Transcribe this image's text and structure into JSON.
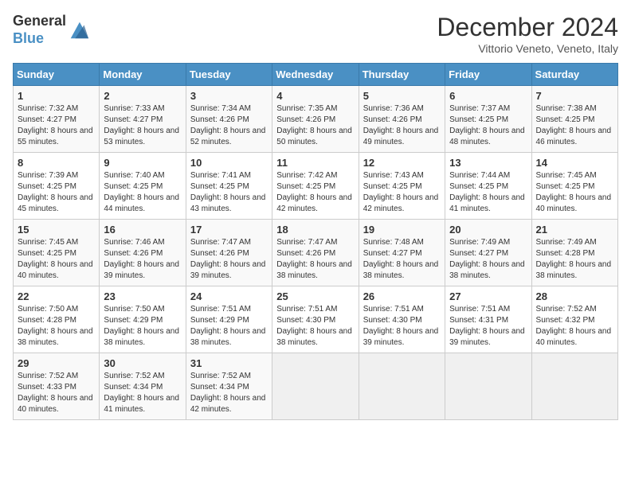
{
  "header": {
    "logo_line1": "General",
    "logo_line2": "Blue",
    "month_title": "December 2024",
    "subtitle": "Vittorio Veneto, Veneto, Italy"
  },
  "days_of_week": [
    "Sunday",
    "Monday",
    "Tuesday",
    "Wednesday",
    "Thursday",
    "Friday",
    "Saturday"
  ],
  "weeks": [
    [
      {
        "day": "1",
        "sunrise": "7:32 AM",
        "sunset": "4:27 PM",
        "daylight": "8 hours and 55 minutes."
      },
      {
        "day": "2",
        "sunrise": "7:33 AM",
        "sunset": "4:27 PM",
        "daylight": "8 hours and 53 minutes."
      },
      {
        "day": "3",
        "sunrise": "7:34 AM",
        "sunset": "4:26 PM",
        "daylight": "8 hours and 52 minutes."
      },
      {
        "day": "4",
        "sunrise": "7:35 AM",
        "sunset": "4:26 PM",
        "daylight": "8 hours and 50 minutes."
      },
      {
        "day": "5",
        "sunrise": "7:36 AM",
        "sunset": "4:26 PM",
        "daylight": "8 hours and 49 minutes."
      },
      {
        "day": "6",
        "sunrise": "7:37 AM",
        "sunset": "4:25 PM",
        "daylight": "8 hours and 48 minutes."
      },
      {
        "day": "7",
        "sunrise": "7:38 AM",
        "sunset": "4:25 PM",
        "daylight": "8 hours and 46 minutes."
      }
    ],
    [
      {
        "day": "8",
        "sunrise": "7:39 AM",
        "sunset": "4:25 PM",
        "daylight": "8 hours and 45 minutes."
      },
      {
        "day": "9",
        "sunrise": "7:40 AM",
        "sunset": "4:25 PM",
        "daylight": "8 hours and 44 minutes."
      },
      {
        "day": "10",
        "sunrise": "7:41 AM",
        "sunset": "4:25 PM",
        "daylight": "8 hours and 43 minutes."
      },
      {
        "day": "11",
        "sunrise": "7:42 AM",
        "sunset": "4:25 PM",
        "daylight": "8 hours and 42 minutes."
      },
      {
        "day": "12",
        "sunrise": "7:43 AM",
        "sunset": "4:25 PM",
        "daylight": "8 hours and 42 minutes."
      },
      {
        "day": "13",
        "sunrise": "7:44 AM",
        "sunset": "4:25 PM",
        "daylight": "8 hours and 41 minutes."
      },
      {
        "day": "14",
        "sunrise": "7:45 AM",
        "sunset": "4:25 PM",
        "daylight": "8 hours and 40 minutes."
      }
    ],
    [
      {
        "day": "15",
        "sunrise": "7:45 AM",
        "sunset": "4:25 PM",
        "daylight": "8 hours and 40 minutes."
      },
      {
        "day": "16",
        "sunrise": "7:46 AM",
        "sunset": "4:26 PM",
        "daylight": "8 hours and 39 minutes."
      },
      {
        "day": "17",
        "sunrise": "7:47 AM",
        "sunset": "4:26 PM",
        "daylight": "8 hours and 39 minutes."
      },
      {
        "day": "18",
        "sunrise": "7:47 AM",
        "sunset": "4:26 PM",
        "daylight": "8 hours and 38 minutes."
      },
      {
        "day": "19",
        "sunrise": "7:48 AM",
        "sunset": "4:27 PM",
        "daylight": "8 hours and 38 minutes."
      },
      {
        "day": "20",
        "sunrise": "7:49 AM",
        "sunset": "4:27 PM",
        "daylight": "8 hours and 38 minutes."
      },
      {
        "day": "21",
        "sunrise": "7:49 AM",
        "sunset": "4:28 PM",
        "daylight": "8 hours and 38 minutes."
      }
    ],
    [
      {
        "day": "22",
        "sunrise": "7:50 AM",
        "sunset": "4:28 PM",
        "daylight": "8 hours and 38 minutes."
      },
      {
        "day": "23",
        "sunrise": "7:50 AM",
        "sunset": "4:29 PM",
        "daylight": "8 hours and 38 minutes."
      },
      {
        "day": "24",
        "sunrise": "7:51 AM",
        "sunset": "4:29 PM",
        "daylight": "8 hours and 38 minutes."
      },
      {
        "day": "25",
        "sunrise": "7:51 AM",
        "sunset": "4:30 PM",
        "daylight": "8 hours and 38 minutes."
      },
      {
        "day": "26",
        "sunrise": "7:51 AM",
        "sunset": "4:30 PM",
        "daylight": "8 hours and 39 minutes."
      },
      {
        "day": "27",
        "sunrise": "7:51 AM",
        "sunset": "4:31 PM",
        "daylight": "8 hours and 39 minutes."
      },
      {
        "day": "28",
        "sunrise": "7:52 AM",
        "sunset": "4:32 PM",
        "daylight": "8 hours and 40 minutes."
      }
    ],
    [
      {
        "day": "29",
        "sunrise": "7:52 AM",
        "sunset": "4:33 PM",
        "daylight": "8 hours and 40 minutes."
      },
      {
        "day": "30",
        "sunrise": "7:52 AM",
        "sunset": "4:34 PM",
        "daylight": "8 hours and 41 minutes."
      },
      {
        "day": "31",
        "sunrise": "7:52 AM",
        "sunset": "4:34 PM",
        "daylight": "8 hours and 42 minutes."
      },
      null,
      null,
      null,
      null
    ]
  ],
  "labels": {
    "sunrise": "Sunrise:",
    "sunset": "Sunset:",
    "daylight": "Daylight:"
  }
}
